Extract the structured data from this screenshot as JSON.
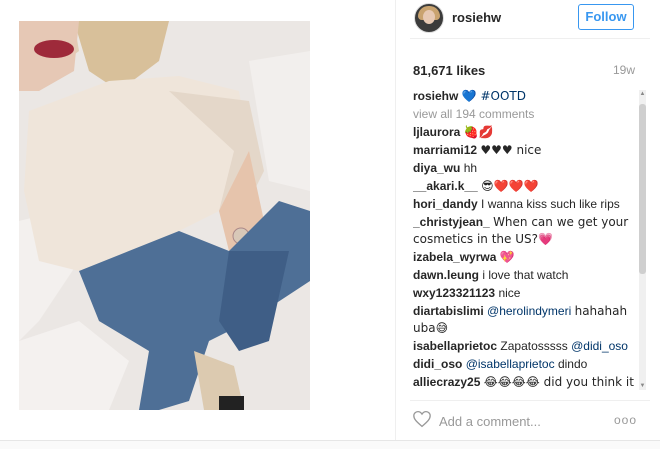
{
  "header": {
    "username": "rosiehw",
    "follow_label": "Follow"
  },
  "post": {
    "likes": "81,671 likes",
    "time": "19w"
  },
  "caption": {
    "user": "rosiehw",
    "text": "💙 #OOTD"
  },
  "view_all": "view all 194 comments",
  "comments": [
    {
      "user": "ljlaurora",
      "text": "🍓💋"
    },
    {
      "user": "marriami12",
      "text": "♥♥♥ nice"
    },
    {
      "user": "diya_wu",
      "text": "hh"
    },
    {
      "user": "__akari.k__",
      "text": "😎❤️❤️❤️"
    },
    {
      "user": "hori_dandy",
      "text": "I wanna kiss such like rips"
    },
    {
      "user": "_christyjean_",
      "text": "When can we get your cosmetics in the US?💗"
    },
    {
      "user": "izabela_wyrwa",
      "text": "💖"
    },
    {
      "user": "dawn.leung",
      "text": "i love that watch"
    },
    {
      "user": "wxy123321123",
      "text": "nice"
    },
    {
      "user": "diartabislimi",
      "mention": "@herolindymeri",
      "text": "hahahah uba😅"
    },
    {
      "user": "isabellaprietoc",
      "text": "Zapatosssss",
      "mention": "@didi_oso"
    },
    {
      "user": "didi_oso",
      "mention": "@isabellaprietoc",
      "text": "dindo"
    },
    {
      "user": "alliecrazy25",
      "text": "😂😂😂😂 did you think it"
    }
  ],
  "footer": {
    "comment_placeholder": "Add a comment...",
    "more": "ooo"
  },
  "colors": {
    "accent": "#3897f0",
    "mention": "#003569"
  }
}
